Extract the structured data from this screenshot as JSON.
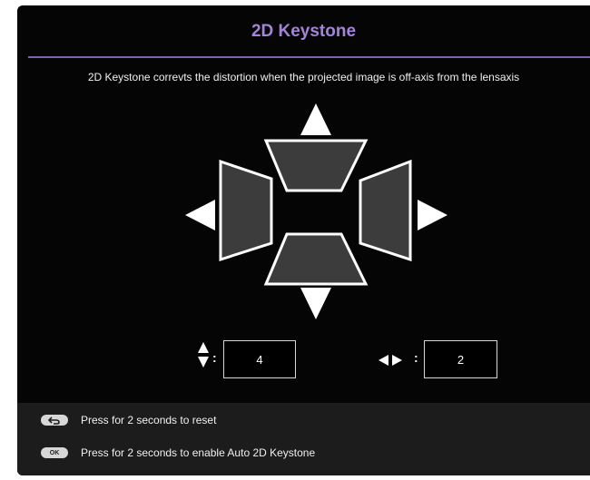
{
  "dialog": {
    "title": "2D Keystone",
    "description": "2D Keystone correvts the distortion when the projected image is off-axis from the lensaxis"
  },
  "values": {
    "vertical": "4",
    "horizontal": "2"
  },
  "hints": [
    {
      "key_icon": "back-arrow-icon",
      "key_label": "",
      "text": "Press for 2 seconds to reset"
    },
    {
      "key_icon": "ok-key-icon",
      "key_label": "OK",
      "text": "Press for 2 seconds to enable Auto 2D Keystone"
    }
  ],
  "colors": {
    "background": "#050505",
    "title": "#a484d8",
    "accent_rule": "#7e62b2",
    "trapezoid_fill": "#3c3c3c",
    "outline": "#ffffff",
    "footer": "#1c1c1c"
  }
}
